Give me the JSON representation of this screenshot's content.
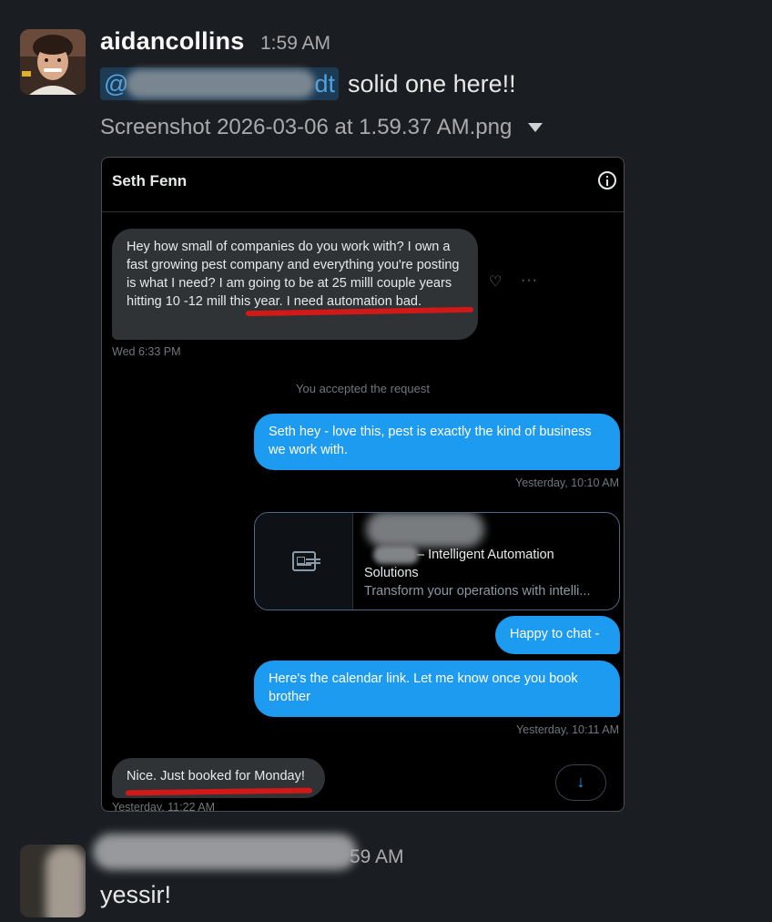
{
  "message1": {
    "author": "aidancollins",
    "time": "1:59 AM",
    "mention_prefix": "@",
    "mention_suffix": "dt",
    "text": "solid one here!!",
    "attachment_name": "Screenshot 2026-03-06 at 1.59.37 AM.png"
  },
  "screenshot": {
    "header_title": "Seth Fenn",
    "incoming_message": "Hey how small of companies do you work with? I own a fast growing pest company and everything you're posting is what I need? I am going to be at 25 milll couple years hitting 10 -12 mill this year. I need automation bad.",
    "incoming_time": "Wed 6:33 PM",
    "system_notice": "You accepted the request",
    "reply1": "Seth hey - love this, pest is exactly the kind of business we work with.",
    "reply1_time": "Yesterday, 10:10 AM",
    "link_card": {
      "title_visible": "– Intelligent Automation Solutions",
      "description": "Transform your operations with intelli..."
    },
    "reply2": "Happy to chat -",
    "reply3": "Here's the calendar link. Let me know once you book brother",
    "reply3_time": "Yesterday, 10:11 AM",
    "final_incoming": "Nice. Just booked for Monday!",
    "final_time_partial": "Yesterday, 11:22 AM",
    "scroll_down_glyph": "↓"
  },
  "message2": {
    "time_partial": "59 AM",
    "text": "yessir!"
  },
  "colors": {
    "background": "#1a1d21",
    "mention_bg": "#1d3b55",
    "bubble_out": "#1d9bf0",
    "bubble_in": "#2f3336",
    "annotation_red": "#d31818"
  }
}
